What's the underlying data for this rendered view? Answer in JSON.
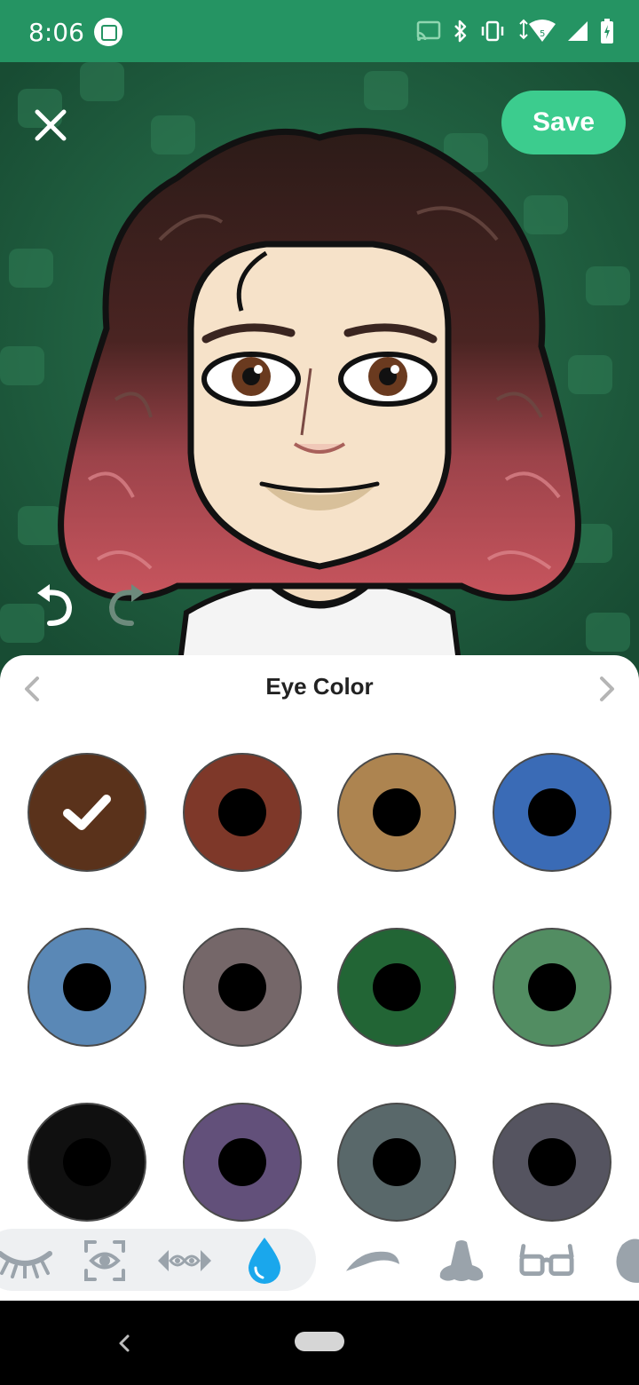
{
  "status_bar": {
    "time": "8:06",
    "icons": [
      "screenshot-app-icon",
      "cast-icon",
      "bluetooth-icon",
      "vibrate-icon",
      "wifi-icon",
      "signal-icon",
      "battery-icon"
    ],
    "background": "#259463"
  },
  "header": {
    "save_label": "Save",
    "close_icon": "close-icon",
    "undo_icon": "undo-icon",
    "redo_icon": "redo-icon"
  },
  "sheet": {
    "title": "Eye Color",
    "prev_icon": "chevron-left-icon",
    "next_icon": "chevron-right-icon"
  },
  "eye_colors": [
    {
      "color": "#5a321b",
      "selected": true
    },
    {
      "color": "#7e3829",
      "selected": false
    },
    {
      "color": "#ad8450",
      "selected": false
    },
    {
      "color": "#3a6bb6",
      "selected": false
    },
    {
      "color": "#5a88b6",
      "selected": false
    },
    {
      "color": "#756769",
      "selected": false
    },
    {
      "color": "#226535",
      "selected": false
    },
    {
      "color": "#528d62",
      "selected": false
    },
    {
      "color": "#101010",
      "selected": false
    },
    {
      "color": "#62507a",
      "selected": false
    },
    {
      "color": "#59686a",
      "selected": false
    },
    {
      "color": "#555460",
      "selected": false
    }
  ],
  "categories": [
    {
      "icon": "eyelashes-icon",
      "active": false
    },
    {
      "icon": "eye-size-icon",
      "active": false
    },
    {
      "icon": "eye-spacing-icon",
      "active": false
    },
    {
      "icon": "eye-color-drop-icon",
      "active": true
    },
    {
      "icon": "eyebrow-icon",
      "active": false
    },
    {
      "icon": "nose-icon",
      "active": false
    },
    {
      "icon": "glasses-icon",
      "active": false
    },
    {
      "icon": "ear-icon",
      "active": false
    }
  ],
  "accent_color": "#3ccc8e",
  "active_icon_color": "#1aa7ec"
}
